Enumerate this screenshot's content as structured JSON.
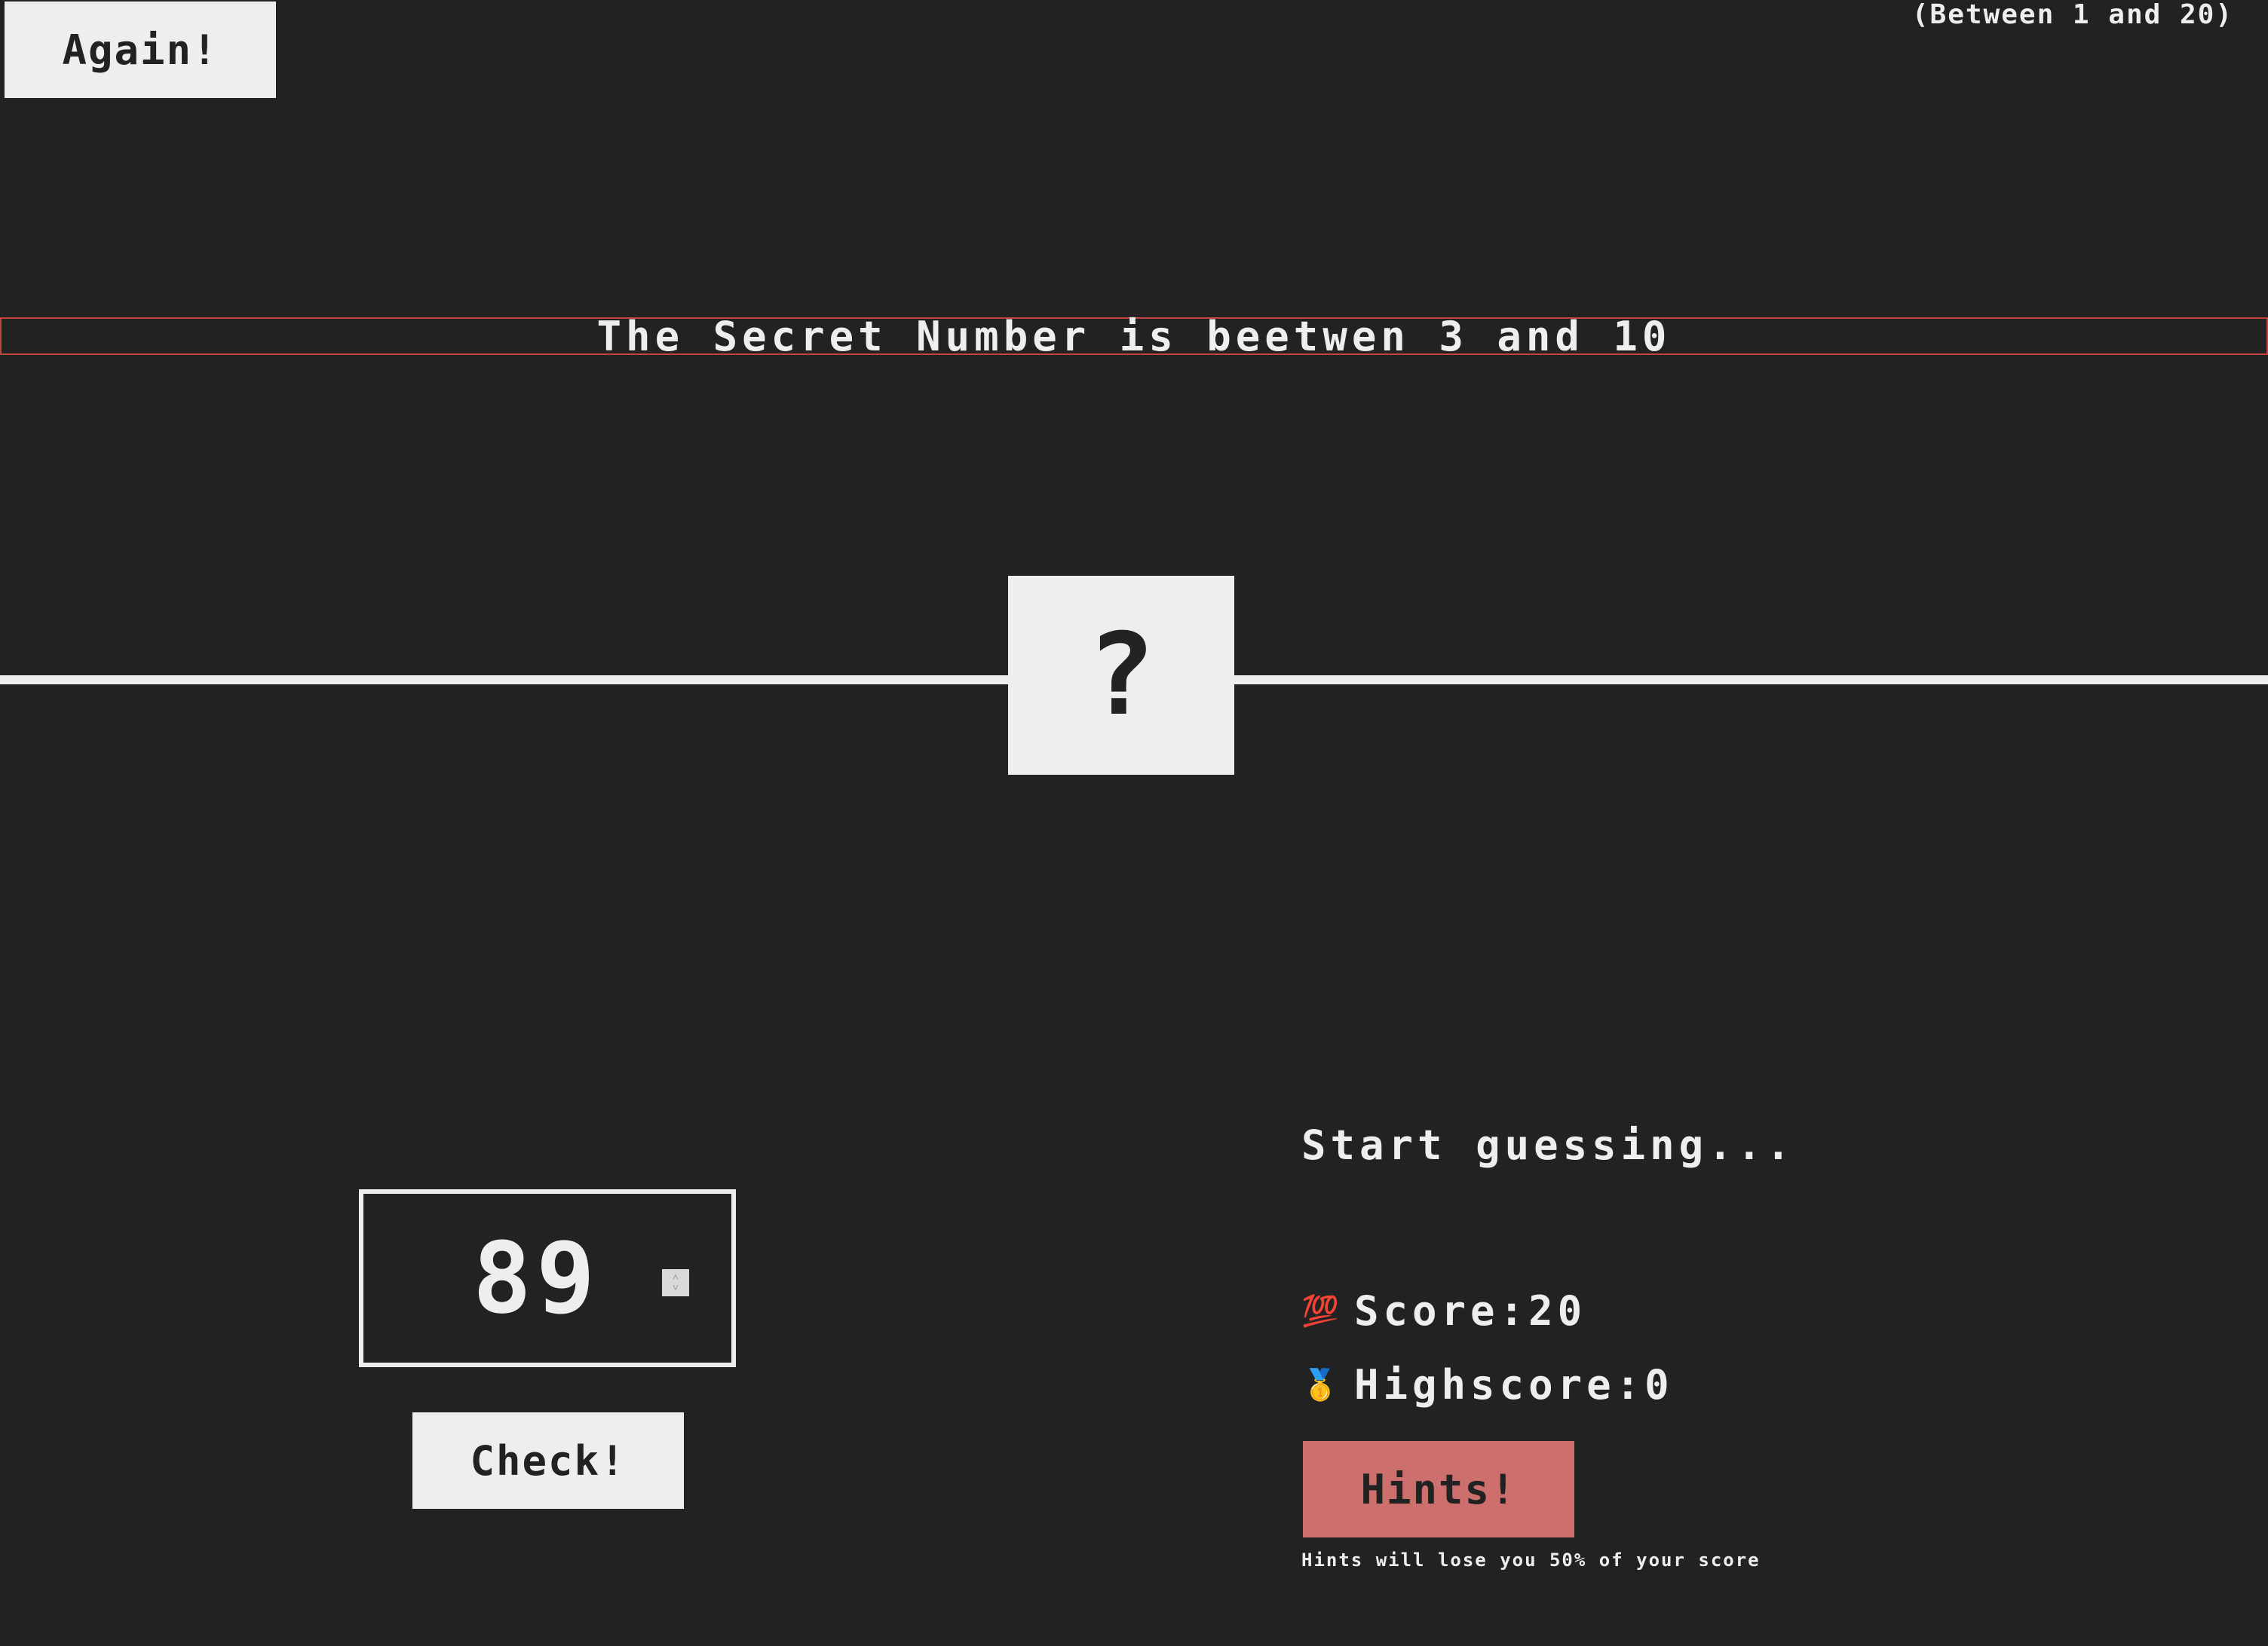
{
  "header": {
    "again_label": "Again!",
    "range_note": "(Between 1 and 20)"
  },
  "message_banner": "The Secret Number is beetwen 3 and 10",
  "secret": {
    "display": "?"
  },
  "guess": {
    "value": "89"
  },
  "check_label": "Check!",
  "status_message": "Start guessing...",
  "stats": {
    "score_icon": "💯",
    "score_label": "Score: ",
    "score_value": "20",
    "highscore_icon": "🥇",
    "highscore_label": "Highscore: ",
    "highscore_value": "0"
  },
  "hints": {
    "label": "Hints!",
    "note": "Hints will lose you 50% of your score"
  },
  "colors": {
    "background": "#222222",
    "foreground": "#eeeeee",
    "hints_button": "#cc6f6d",
    "banner_border": "#c0453f"
  }
}
